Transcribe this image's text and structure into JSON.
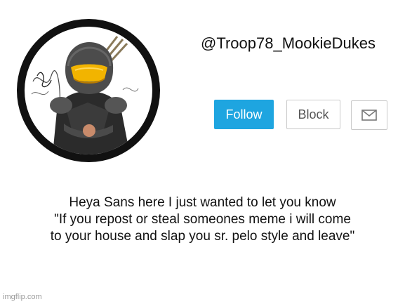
{
  "profile": {
    "username": "@Troop78_MookieDukes",
    "avatar_icon": "soldier-avatar-icon"
  },
  "actions": {
    "follow_label": "Follow",
    "block_label": "Block",
    "message_icon": "mail-icon"
  },
  "announcement": {
    "lines": [
      "Heya Sans here I just wanted to let you know",
      "\"If you repost or steal someones meme i will come",
      "to your house and slap you sr. pelo style and leave\""
    ]
  },
  "watermark": "imgflip.com",
  "colors": {
    "follow_button": "#1ea5e0",
    "ring": "#111111",
    "visor": "#f2b400"
  }
}
